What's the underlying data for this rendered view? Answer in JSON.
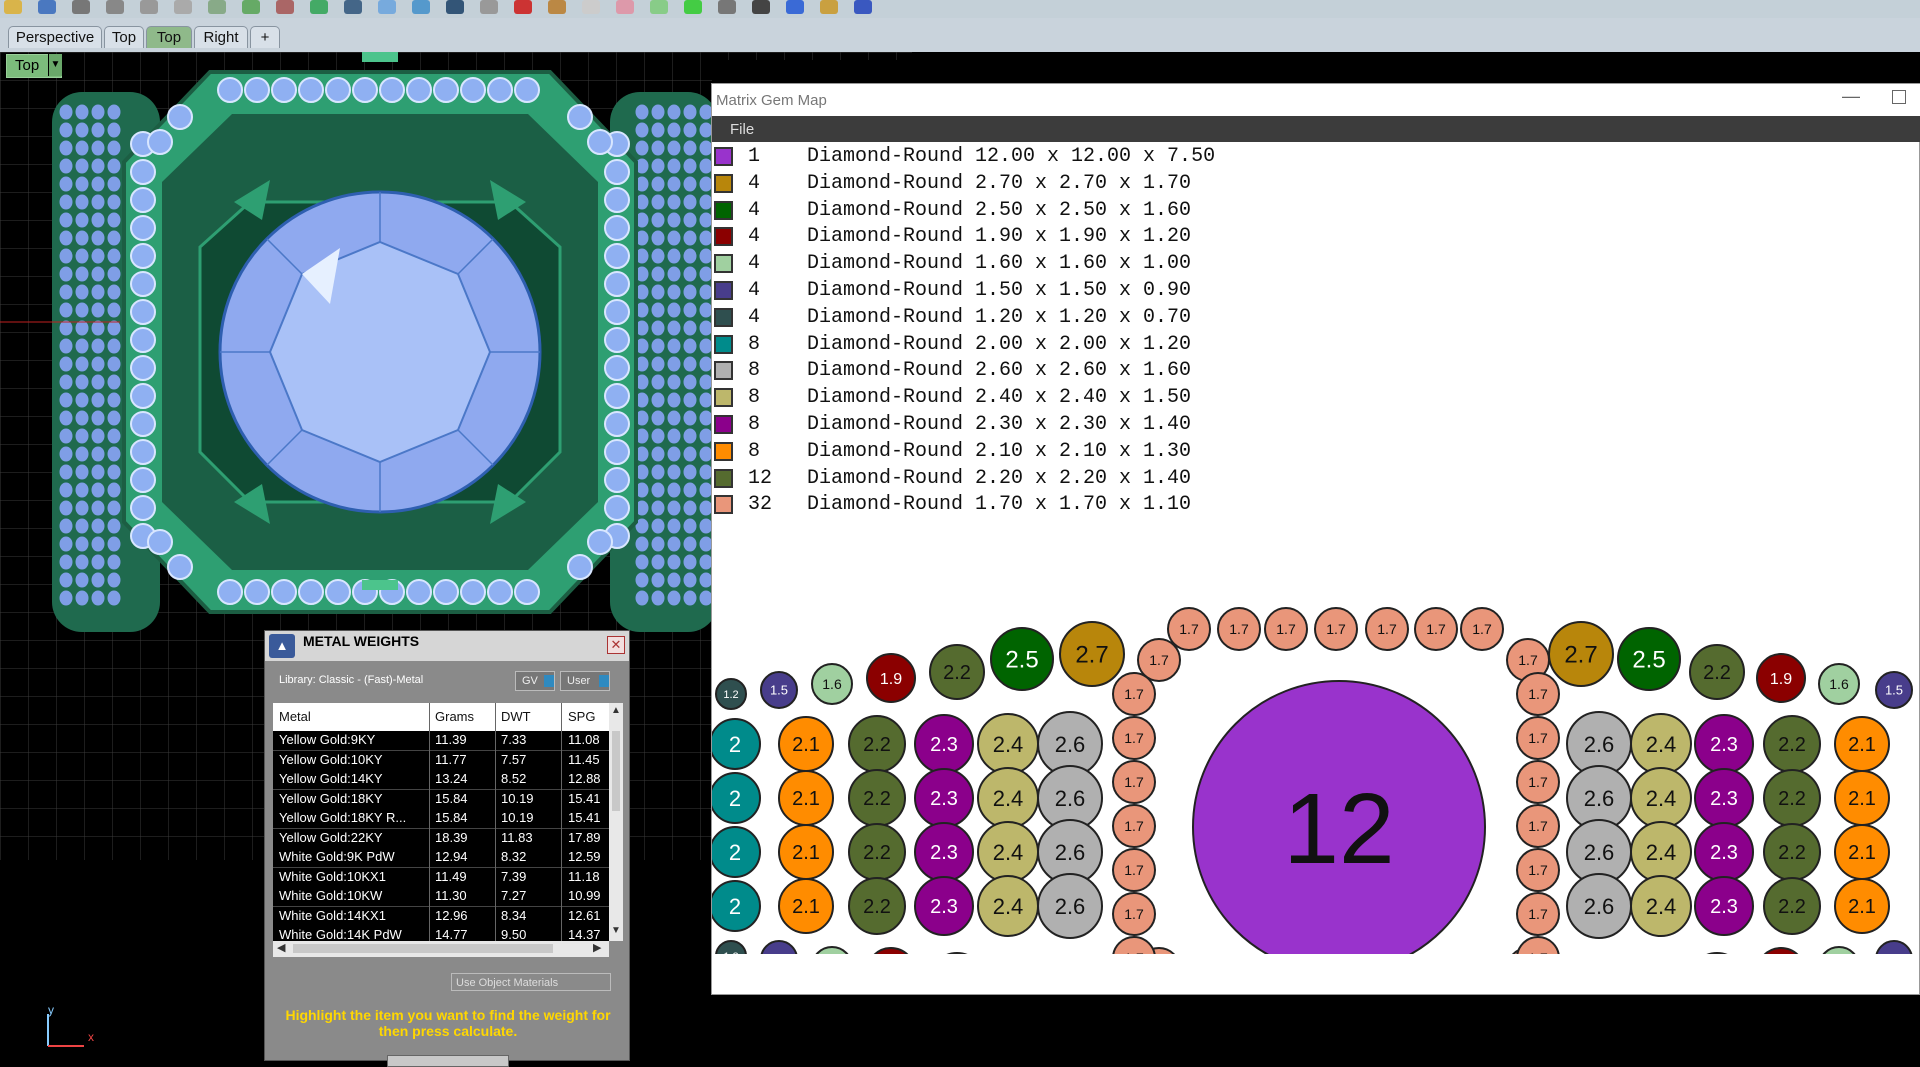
{
  "toolbar": {
    "icons": [
      "folder-icon",
      "save-icon",
      "print-icon",
      "new-icon",
      "cut-icon",
      "copy-icon",
      "paste-icon",
      "undo-icon",
      "redo-icon",
      "pan-icon",
      "rotate-icon",
      "zoom-icon",
      "zoom-window-icon",
      "zoom-extents-icon",
      "grid-icon",
      "render-icon",
      "object-icon",
      "point-icon",
      "light-icon",
      "layer-icon",
      "material-icon",
      "sphere-icon",
      "shaded-icon",
      "settings-icon",
      "tools-icon",
      "help-icon"
    ]
  },
  "tabs": [
    {
      "label": "Perspective",
      "active": false
    },
    {
      "label": "Top",
      "active": false
    },
    {
      "label": "Top",
      "active": true
    },
    {
      "label": "Right",
      "active": false
    },
    {
      "label": "+",
      "active": false
    }
  ],
  "viewport": {
    "label": "Top",
    "axis_y": "y",
    "axis_x": "x"
  },
  "gem_map": {
    "title": "Matrix Gem Map",
    "menu": [
      "File"
    ],
    "legend": [
      {
        "count": "1",
        "desc": "Diamond-Round 12.00 x 12.00 x 7.50",
        "color": "#9933cc"
      },
      {
        "count": "4",
        "desc": "Diamond-Round 2.70 x 2.70 x 1.70",
        "color": "#b8860b"
      },
      {
        "count": "4",
        "desc": "Diamond-Round 2.50 x 2.50 x 1.60",
        "color": "#006400"
      },
      {
        "count": "4",
        "desc": "Diamond-Round 1.90 x 1.90 x 1.20",
        "color": "#8b0000"
      },
      {
        "count": "4",
        "desc": "Diamond-Round 1.60 x 1.60 x 1.00",
        "color": "#a0d0a0"
      },
      {
        "count": "4",
        "desc": "Diamond-Round 1.50 x 1.50 x 0.90",
        "color": "#483d8b"
      },
      {
        "count": "4",
        "desc": "Diamond-Round 1.20 x 1.20 x 0.70",
        "color": "#2f4f4f"
      },
      {
        "count": "8",
        "desc": "Diamond-Round 2.00 x 2.00 x 1.20",
        "color": "#008b8b"
      },
      {
        "count": "8",
        "desc": "Diamond-Round 2.60 x 2.60 x 1.60",
        "color": "#b0b0b0"
      },
      {
        "count": "8",
        "desc": "Diamond-Round 2.40 x 2.40 x 1.50",
        "color": "#bdb76b"
      },
      {
        "count": "8",
        "desc": "Diamond-Round 2.30 x 2.30 x 1.40",
        "color": "#8b008b"
      },
      {
        "count": "8",
        "desc": "Diamond-Round 2.10 x 2.10 x 1.30",
        "color": "#ff8c00"
      },
      {
        "count": "12",
        "desc": "Diamond-Round 2.20 x 2.20 x 1.40",
        "color": "#556b2f"
      },
      {
        "count": "32",
        "desc": "Diamond-Round 1.70 x 1.70 x 1.10",
        "color": "#e9967a"
      }
    ],
    "map_stones": {
      "center": {
        "label": "12",
        "color": "#9933cc"
      },
      "s27": {
        "label": "2.7",
        "color": "#b8860b"
      },
      "s25": {
        "label": "2.5",
        "color": "#006400"
      },
      "s22": {
        "label": "2.2",
        "color": "#556b2f"
      },
      "s19": {
        "label": "1.9",
        "color": "#8b0000"
      },
      "s16": {
        "label": "1.6",
        "color": "#a0d0a0"
      },
      "s15": {
        "label": "1.5",
        "color": "#483d8b"
      },
      "s12": {
        "label": "1.2",
        "color": "#2f4f4f"
      },
      "s20": {
        "label": "2",
        "color": "#008b8b"
      },
      "s21": {
        "label": "2.1",
        "color": "#ff8c00"
      },
      "s23": {
        "label": "2.3",
        "color": "#8b008b"
      },
      "s24": {
        "label": "2.4",
        "color": "#bdb76b"
      },
      "s26": {
        "label": "2.6",
        "color": "#b0b0b0"
      },
      "s17": {
        "label": "1.7",
        "color": "#e9967a"
      }
    }
  },
  "metal_weights": {
    "title": "METAL WEIGHTS",
    "library": "Library: Classic - (Fast)-Metal",
    "gv_label": "GV",
    "user_label": "User",
    "columns": [
      "Metal",
      "Grams",
      "DWT",
      "SPG"
    ],
    "rows": [
      [
        "Yellow Gold:9KY",
        "11.39",
        "7.33",
        "11.08"
      ],
      [
        "Yellow Gold:10KY",
        "11.77",
        "7.57",
        "11.45"
      ],
      [
        "Yellow Gold:14KY",
        "13.24",
        "8.52",
        "12.88"
      ],
      [
        "Yellow Gold:18KY",
        "15.84",
        "10.19",
        "15.41"
      ],
      [
        "Yellow Gold:18KY R...",
        "15.84",
        "10.19",
        "15.41"
      ],
      [
        "Yellow Gold:22KY",
        "18.39",
        "11.83",
        "17.89"
      ],
      [
        "White Gold:9K PdW",
        "12.94",
        "8.32",
        "12.59"
      ],
      [
        "White Gold:10KX1",
        "11.49",
        "7.39",
        "11.18"
      ],
      [
        "White Gold:10KW",
        "11.30",
        "7.27",
        "10.99"
      ],
      [
        "White Gold:14KX1",
        "12.96",
        "8.34",
        "12.61"
      ],
      [
        "White Gold:14K PdW",
        "14.77",
        "9.50",
        "14.37"
      ]
    ],
    "use_object_materials": "Use Object Materials",
    "hint": "Highlight the item you want to find the weight for then press calculate."
  }
}
